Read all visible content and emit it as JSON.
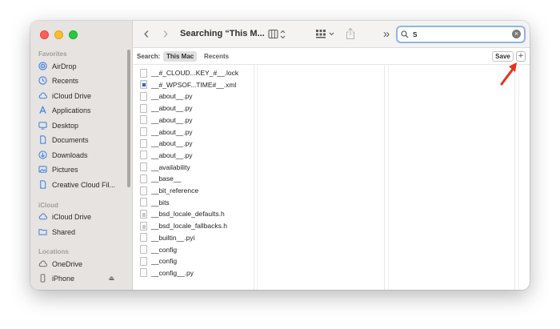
{
  "window": {
    "title": "Searching “This M..."
  },
  "sidebar": {
    "sections": [
      {
        "title": "Favorites",
        "items": [
          {
            "label": "AirDrop",
            "icon": "airdrop-icon"
          },
          {
            "label": "Recents",
            "icon": "clock-icon"
          },
          {
            "label": "iCloud Drive",
            "icon": "cloud-icon"
          },
          {
            "label": "Applications",
            "icon": "applications-icon"
          },
          {
            "label": "Desktop",
            "icon": "desktop-icon"
          },
          {
            "label": "Documents",
            "icon": "document-icon"
          },
          {
            "label": "Downloads",
            "icon": "download-icon"
          },
          {
            "label": "Pictures",
            "icon": "pictures-icon"
          },
          {
            "label": "Creative Cloud Fil...",
            "icon": "document-icon"
          }
        ]
      },
      {
        "title": "iCloud",
        "items": [
          {
            "label": "iCloud Drive",
            "icon": "cloud-icon"
          },
          {
            "label": "Shared",
            "icon": "shared-folder-icon"
          }
        ]
      },
      {
        "title": "Locations",
        "items": [
          {
            "label": "OneDrive",
            "icon": "cloud-icon"
          },
          {
            "label": "iPhone",
            "icon": "iphone-icon",
            "eject": "⏏"
          }
        ]
      }
    ]
  },
  "toolbar": {
    "back": "‹",
    "forward": "›",
    "more": "»",
    "search_value": "s",
    "clear": "×"
  },
  "scopebar": {
    "label": "Search:",
    "scopes": [
      "This Mac",
      "Recents"
    ],
    "active_scope": "This Mac",
    "save_label": "Save",
    "add_label": "+"
  },
  "files": [
    {
      "name": "__#_CLOUD...KEY_#__.lock",
      "kind": "plain"
    },
    {
      "name": "__#_WPSOF...TIME#__.xml",
      "kind": "xml"
    },
    {
      "name": "__about__.py",
      "kind": "plain"
    },
    {
      "name": "__about__.py",
      "kind": "plain"
    },
    {
      "name": "__about__.py",
      "kind": "plain"
    },
    {
      "name": "__about__.py",
      "kind": "plain"
    },
    {
      "name": "__about__.py",
      "kind": "plain"
    },
    {
      "name": "__about__.py",
      "kind": "plain"
    },
    {
      "name": "__availability",
      "kind": "plain"
    },
    {
      "name": "__base__",
      "kind": "plain"
    },
    {
      "name": "__bit_reference",
      "kind": "plain"
    },
    {
      "name": "__bits",
      "kind": "plain"
    },
    {
      "name": "__bsd_locale_defaults.h",
      "kind": "h"
    },
    {
      "name": "__bsd_locale_fallbacks.h",
      "kind": "h"
    },
    {
      "name": "__builtin__.pyi",
      "kind": "plain"
    },
    {
      "name": "__config",
      "kind": "plain"
    },
    {
      "name": "__config",
      "kind": "plain"
    },
    {
      "name": "__config__.py",
      "kind": "plain"
    }
  ],
  "colors": {
    "accent": "#8db6ea",
    "annotation_arrow": "#e8321e"
  }
}
